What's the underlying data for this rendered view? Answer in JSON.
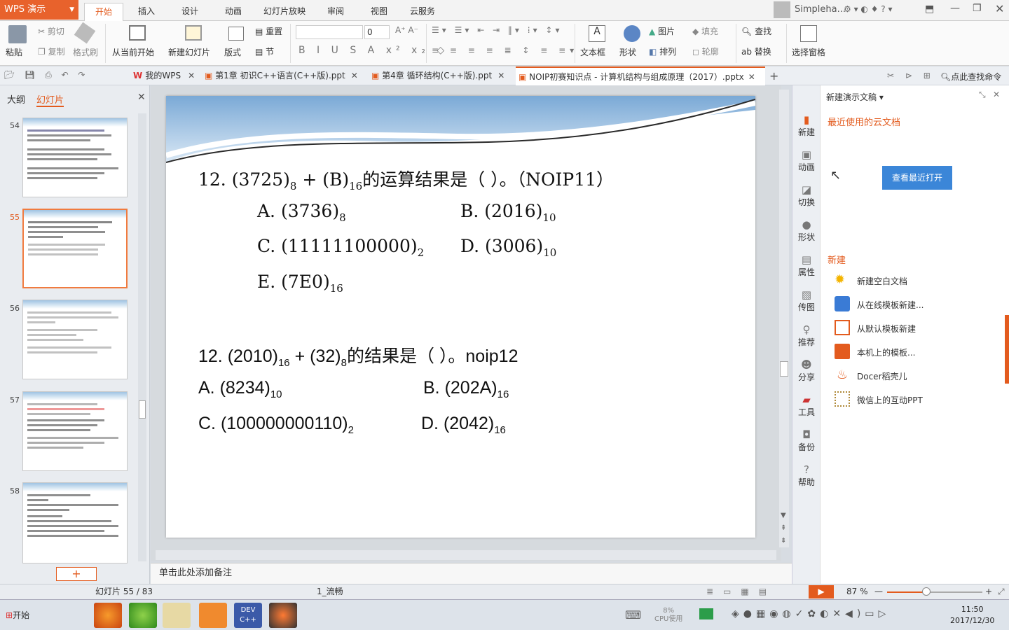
{
  "app": {
    "name": "WPS 演示",
    "user": "Simpleha..."
  },
  "menu": [
    "开始",
    "插入",
    "设计",
    "动画",
    "幻灯片放映",
    "审阅",
    "视图",
    "云服务"
  ],
  "ribbon": {
    "paste": "粘贴",
    "cut": "剪切",
    "copy": "复制",
    "format_painter": "格式刷",
    "from_current": "从当前开始",
    "new_slide": "新建幻灯片",
    "layout": "版式",
    "reset": "重置",
    "section": "节",
    "font_size": "0",
    "textbox": "文本框",
    "shape": "形状",
    "picture": "图片",
    "fill": "填充",
    "arrange": "排列",
    "outline": "轮廓",
    "find": "查找",
    "replace": "替换",
    "select_pane": "选择窗格"
  },
  "doctabs": [
    "我的WPS",
    "第1章 初识C++语言(C++版).ppt",
    "第4章 循环结构(C++版).ppt",
    "NOIP初赛知识点 - 计算机结构与组成原理（2017）.pptx"
  ],
  "doctab_search": "点此查找命令",
  "leftpane": {
    "tabs": [
      "大纲",
      "幻灯片"
    ],
    "slides": [
      "54",
      "55",
      "56",
      "57",
      "58"
    ]
  },
  "slide": {
    "q1": {
      "stem": "12.  (3725)",
      "b1": "8",
      "plus": " + (B)",
      "b2": "16",
      "tail": "的运算结果是（      ）。（NOIP11）",
      "A": "A.  (3736)",
      "Ab": "8",
      "B": "B.  (2016)",
      "Bb": "10",
      "C": "C.  (11111100000)",
      "Cb": "2",
      "D": "D.  (3006)",
      "Db": "10",
      "E": "E.  (7E0)",
      "Eb": "16"
    },
    "q2": {
      "stem": "12. (2010)",
      "b1": "16",
      "plus": " + (32)",
      "b2": "8",
      "tail": "的结果是（    ）。noip12",
      "A": "A. (8234)",
      "Ab": "10",
      "B": "B. (202A)",
      "Bb": "16",
      "C": "C. (100000000110)",
      "Cb": "2",
      "D": "D. (2042)",
      "Db": "16"
    }
  },
  "notes": "单击此处添加备注",
  "rightnav": [
    "新建",
    "动画",
    "切换",
    "形状",
    "属性",
    "传图",
    "推荐",
    "分享",
    "工具",
    "备份",
    "帮助"
  ],
  "rightpanel": {
    "title": "新建演示文稿",
    "recent": "最近使用的云文档",
    "open_recent": "查看最近打开",
    "new_heading": "新建",
    "items": [
      "新建空白文档",
      "从在线模板新建...",
      "从默认模板新建",
      "本机上的模板...",
      "Docer稻壳儿",
      "微信上的互动PPT"
    ]
  },
  "status": {
    "slide_pos": "幻灯片 55 / 83",
    "theme": "1_流畅",
    "zoom": "87 %"
  },
  "taskbar": {
    "start": "开始",
    "cpu_pct": "8%",
    "cpu_label": "CPU使用",
    "time": "11:50",
    "date": "2017/12/30"
  }
}
